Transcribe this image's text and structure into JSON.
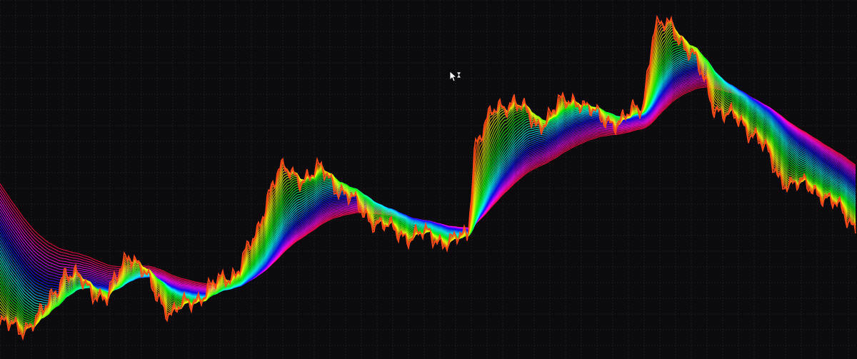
{
  "chart_data": {
    "type": "line",
    "title": "",
    "xlabel": "",
    "ylabel": "",
    "grid": true,
    "ylim": [
      0,
      100
    ],
    "price_color": "#ff4a1a",
    "ma_count": 44,
    "ma_period_range": [
      2,
      120
    ],
    "hue_range": [
      15,
      345
    ],
    "x": [
      0,
      30,
      60,
      90,
      120,
      150,
      180,
      210,
      240,
      270,
      300,
      330,
      360,
      375,
      390,
      420,
      450,
      480,
      510,
      540,
      570,
      600,
      630,
      655,
      665,
      690,
      720,
      750,
      780,
      810,
      840,
      870,
      900,
      915,
      940,
      970,
      1000,
      1030,
      1060,
      1090,
      1120,
      1150,
      1180,
      1200
    ],
    "price": [
      9.5,
      8.5,
      12.5,
      24.5,
      20.5,
      16.5,
      30.5,
      20.5,
      12.5,
      16.5,
      20.5,
      24.5,
      34.5,
      46.5,
      52.5,
      50.5,
      52.5,
      46.5,
      40.5,
      36.5,
      34.5,
      34.5,
      32.5,
      34.5,
      60.5,
      68.5,
      72.5,
      64.5,
      70.5,
      72.5,
      66.5,
      66.5,
      70.5,
      92.5,
      92.5,
      84.5,
      70.5,
      66.5,
      62.5,
      50.5,
      48.5,
      46.5,
      40.5,
      36.5
    ],
    "series_start_offsets": [
      0,
      40
    ]
  }
}
